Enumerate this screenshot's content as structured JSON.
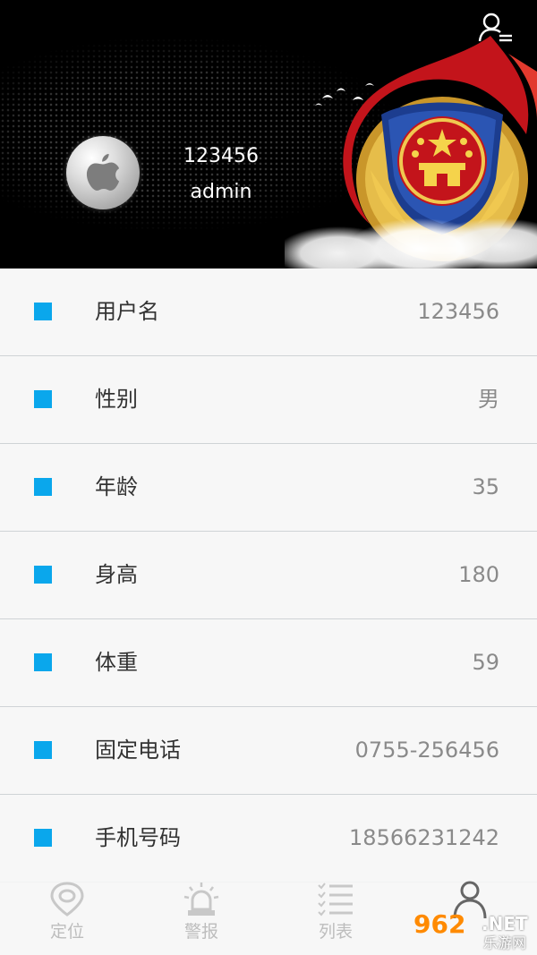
{
  "header": {
    "user_id": "123456",
    "user_name": "admin",
    "colors": {
      "background": "#000000",
      "emblem_red": "#d31a1a",
      "emblem_gold": "#e2b43a",
      "emblem_blue": "#1f3a8a"
    }
  },
  "profile": {
    "rows": [
      {
        "label": "用户名",
        "value": "123456"
      },
      {
        "label": "性别",
        "value": "男"
      },
      {
        "label": "年龄",
        "value": "35"
      },
      {
        "label": "身高",
        "value": "180"
      },
      {
        "label": "体重",
        "value": "59"
      },
      {
        "label": "固定电话",
        "value": "0755-256456"
      },
      {
        "label": "手机号码",
        "value": "18566231242"
      }
    ],
    "bullet_color": "#0aa7ec"
  },
  "tabs": [
    {
      "label": "定位",
      "icon": "location-icon"
    },
    {
      "label": "警报",
      "icon": "alarm-icon"
    },
    {
      "label": "列表",
      "icon": "list-icon"
    },
    {
      "label": "",
      "icon": "person-icon",
      "active": true
    }
  ],
  "watermark": {
    "brand": "962",
    "suffix": ".NET",
    "sub": "乐游网"
  }
}
